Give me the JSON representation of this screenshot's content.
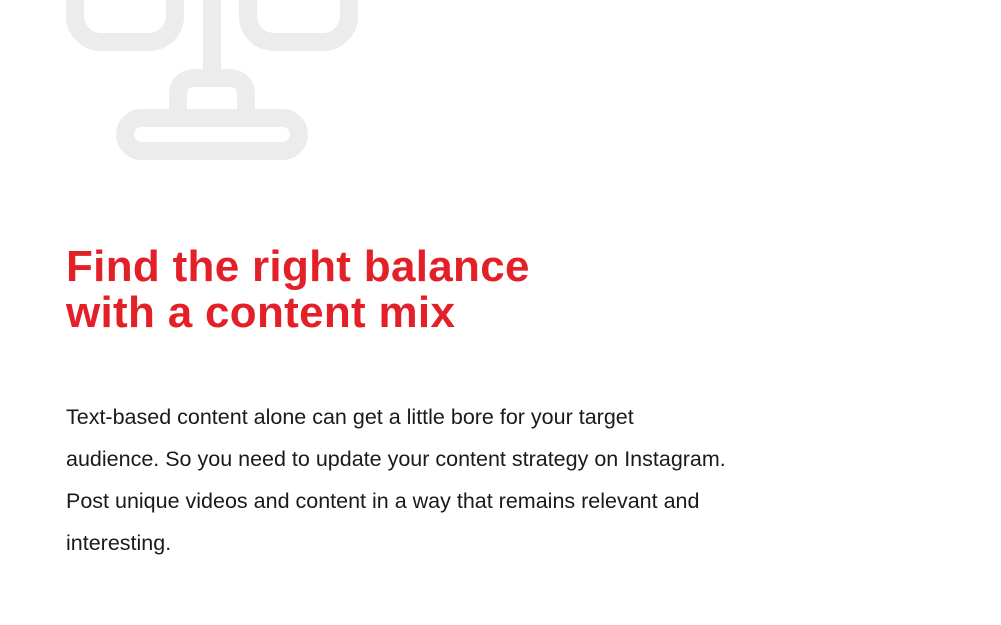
{
  "colors": {
    "heading": "#e32027",
    "body_text": "#1a1a1a",
    "illustration": "#ececec",
    "background": "#ffffff"
  },
  "illustration": {
    "icon": "balance-scale-icon"
  },
  "heading": {
    "line1": "Find the right balance",
    "line2": "with a content mix"
  },
  "body": {
    "lines": [
      "Text-based content alone can get a little bore for your target",
      "audience. So you need to update your content strategy on Instagram.",
      "Post unique videos and content in a way that remains relevant and",
      "interesting."
    ]
  }
}
